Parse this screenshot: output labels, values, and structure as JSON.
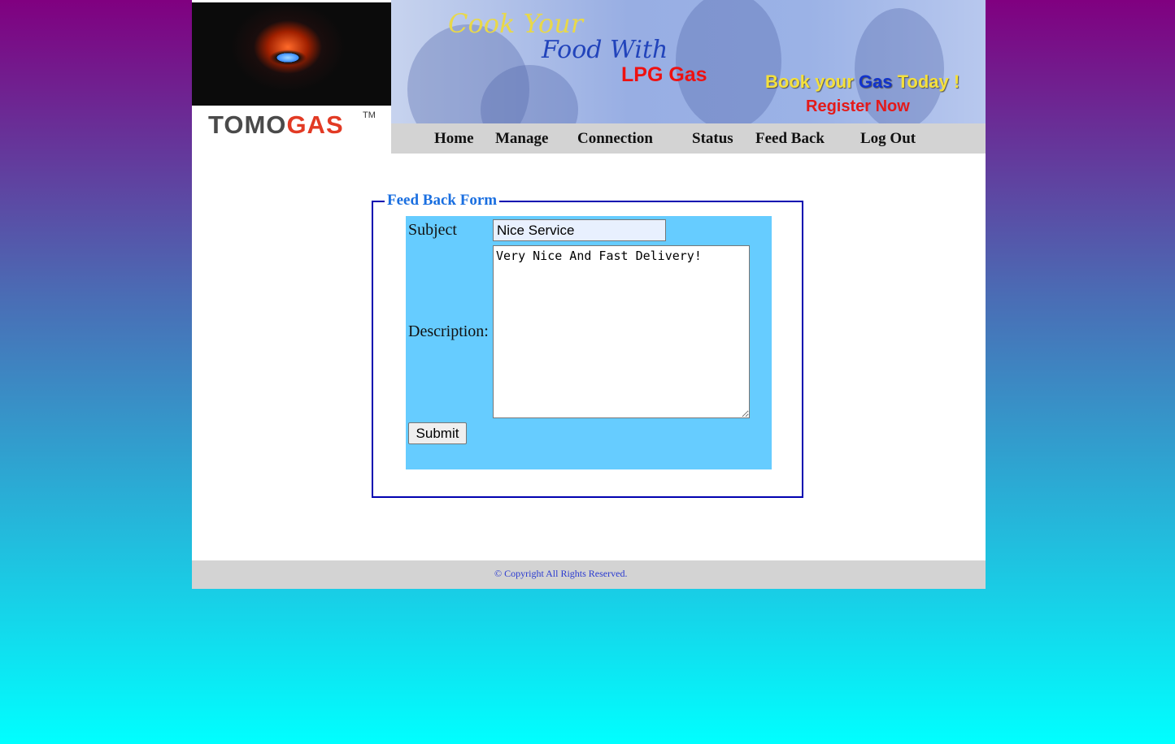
{
  "logo": {
    "brand_part1": "TOMO",
    "brand_part2": "GAS",
    "trademark": "TM"
  },
  "banner": {
    "line1": "Cook Your",
    "line2": "Food With",
    "line3": "LPG Gas",
    "line4_a": "Book your ",
    "line4_b": "Gas",
    "line4_c": " Today !",
    "line5": "Register Now"
  },
  "nav": {
    "home": "Home",
    "manage": "Manage",
    "connection": "Connection",
    "status": "Status",
    "feedback": "Feed Back",
    "logout": "Log Out"
  },
  "form": {
    "legend": "Feed Back Form",
    "subject_label": "Subject",
    "subject_value": "Nice Service",
    "description_label": "Description:",
    "description_value": "Very Nice And Fast Delivery!",
    "submit_label": "Submit"
  },
  "footer": {
    "copyright": "© Copyright All Rights Reserved."
  },
  "colors": {
    "legend": "#1a6fe0",
    "form_bg": "#66ccff",
    "fieldset_border": "#0000b0",
    "nav_bg": "#d3d3d3"
  }
}
